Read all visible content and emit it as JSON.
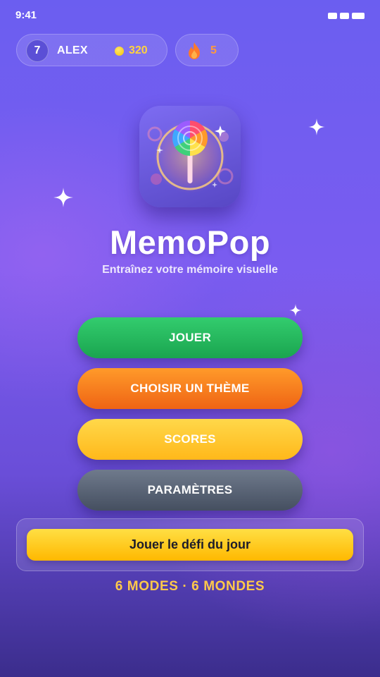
{
  "status_bar": {
    "time": "9:41"
  },
  "player": {
    "level": "7",
    "name": "ALEX",
    "coins": "320",
    "streak": "5"
  },
  "app": {
    "title": "MemoPop",
    "subtitle": "Entraînez votre mémoire visuelle"
  },
  "menu": {
    "play": "JOUER",
    "choose_theme": "CHOISIR UN THÈME",
    "scores": "SCORES",
    "settings": "PARAMÈTRES"
  },
  "daily_challenge": {
    "label": "Jouer le défi du jour"
  },
  "footer": {
    "modes": "6 MODES · 6 MONDES"
  },
  "icons": {
    "coin": "coin-icon",
    "streak": "flame-icon",
    "app": "lollipop-icon",
    "decor": "sparkle-icon"
  },
  "colors": {
    "play": "#1fb85a",
    "theme": "#f57c1e",
    "scores": "#ffc72c",
    "settings": "#566072",
    "daily": "#ffcc1a",
    "coins_text": "#ffd23e",
    "streak_text": "#ff9a3c",
    "footer_text": "#ffc94a"
  }
}
